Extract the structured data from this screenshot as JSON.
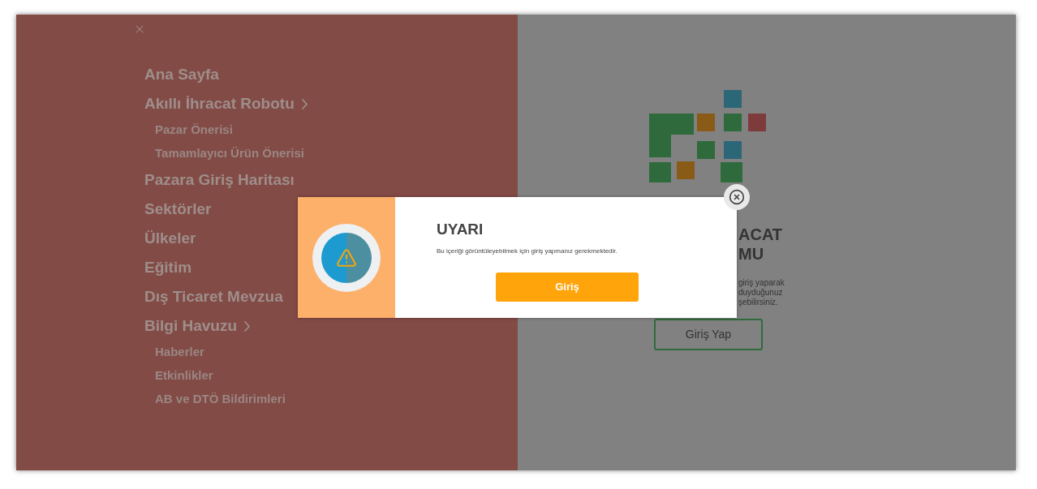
{
  "menu": {
    "items": [
      {
        "label": "Ana Sayfa"
      },
      {
        "label": "Akıllı İhracat Robotu",
        "children": [
          {
            "label": "Pazar Önerisi"
          },
          {
            "label": "Tamamlayıcı Ürün Önerisi"
          }
        ]
      },
      {
        "label": "Pazara Giriş Haritası"
      },
      {
        "label": "Sektörler"
      },
      {
        "label": "Ülkeler"
      },
      {
        "label": "Eğitim"
      },
      {
        "label": "Dış Ticaret Mevzua"
      },
      {
        "label": "Bilgi Havuzu",
        "children": [
          {
            "label": "Haberler"
          },
          {
            "label": "Etkinlikler"
          },
          {
            "label": "AB ve DTÖ Bildirimleri"
          }
        ]
      }
    ]
  },
  "right_panel": {
    "heading_lines": [
      "ACAT",
      "MU"
    ],
    "text_lines": [
      "giriş yaparak",
      "duyduğunuz",
      "şebilirsiniz."
    ],
    "button": "Giriş Yap"
  },
  "modal": {
    "title": "UYARI",
    "message": "Bu içeriği görüntüleyebilmek için giriş yapmanız gerekmektedir.",
    "button": "Giriş"
  }
}
